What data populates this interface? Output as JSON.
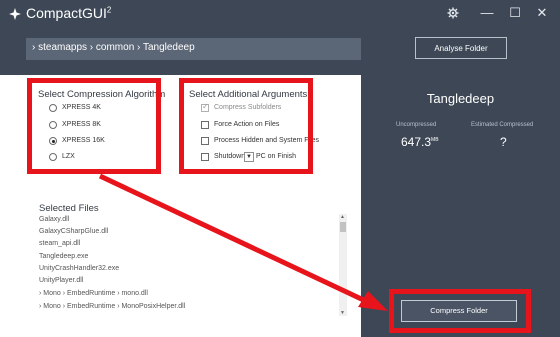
{
  "window": {
    "title": "CompactGUI",
    "title_superscript": "2"
  },
  "titlebar": {
    "settings_icon": "gear-icon",
    "minimize_glyph": "—",
    "maximize_glyph": "☐",
    "close_glyph": "✕"
  },
  "path": {
    "text": "› steamapps › common › Tangledeep"
  },
  "toolbar": {
    "analyse_label": "Analyse Folder"
  },
  "compression": {
    "title": "Select Compression Algorithm",
    "options": [
      {
        "label": "XPRESS 4K",
        "checked": false
      },
      {
        "label": "XPRESS 8K",
        "checked": false
      },
      {
        "label": "XPRESS 16K",
        "checked": true
      },
      {
        "label": "LZX",
        "checked": false
      }
    ]
  },
  "arguments": {
    "title": "Select Additional Arguments",
    "options": [
      {
        "label": "Compress Subfolders",
        "checked": true,
        "disabled": true
      },
      {
        "label": "Force Action on Files",
        "checked": false
      },
      {
        "label": "Process Hidden and System Files",
        "checked": false
      },
      {
        "label": "Shutdown",
        "checked": false
      }
    ],
    "shutdown_dropdown": "PC on Finish",
    "shutdown_value": ""
  },
  "files": {
    "title": "Selected Files",
    "items": [
      "Galaxy.dll",
      "GalaxyCSharpGlue.dll",
      "steam_api.dll",
      "Tangledeep.exe",
      "UnityCrashHandler32.exe",
      "UnityPlayer.dll",
      "› Mono › EmbedRuntime › mono.dll",
      "› Mono › EmbedRuntime › MonoPosixHelper.dll"
    ]
  },
  "summary": {
    "game": "Tangledeep",
    "uncompressed_label": "Uncompressed",
    "uncompressed_value": "647.3",
    "uncompressed_unit": "MB",
    "estimated_label": "Estimated Compressed",
    "estimated_value": "?"
  },
  "actions": {
    "compress_label": "Compress Folder"
  },
  "colors": {
    "accent_red": "#e8141b",
    "background": "#3d4755",
    "pathbar": "#5b6676"
  }
}
